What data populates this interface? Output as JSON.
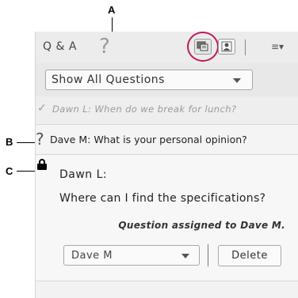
{
  "callouts": {
    "a": "A",
    "b": "B",
    "c": "C"
  },
  "header": {
    "title": "Q & A",
    "icons": [
      "question-mark-icon",
      "question-view-icon",
      "presenter-view-icon",
      "panel-menu-icon"
    ],
    "accent_color": "#c0185b"
  },
  "filter": {
    "selected": "Show All Questions"
  },
  "questions": [
    {
      "status_icon": "check-icon",
      "text": "Dawn  L: When do we break for lunch?"
    },
    {
      "status_icon": "question-mark-icon",
      "text": "Dave  M: What is your personal opinion?"
    },
    {
      "status_icon": "lock-icon",
      "asker": "Dawn  L:",
      "text": "Where can I find the specifications?",
      "assigned_note": "Question assigned to Dave  M.",
      "assignee": "Dave  M",
      "delete_label": "Delete"
    }
  ]
}
